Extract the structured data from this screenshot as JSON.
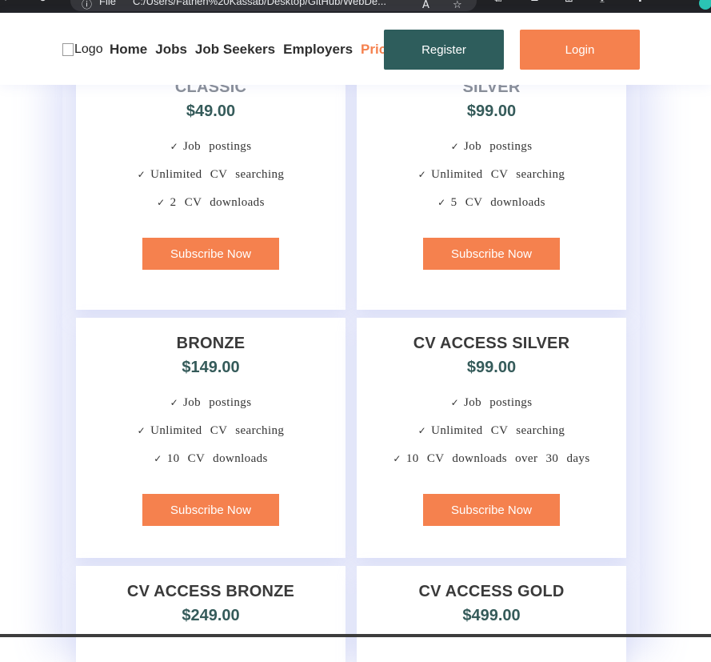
{
  "browser": {
    "file_label": "File",
    "address": "C:/Users/Fathen%20Kassab/Desktop/GitHub/WebDe..."
  },
  "header": {
    "logo_alt": "Logo",
    "nav": [
      "Home",
      "Jobs",
      "Job Seekers",
      "Employers",
      "Pricing"
    ],
    "active_nav": "Pricing",
    "register_label": "Register",
    "login_label": "Login"
  },
  "plans": [
    {
      "name": "CLASSIC",
      "price": "$49.00",
      "features": [
        "Job postings",
        "Unlimited CV searching",
        "2 CV downloads"
      ],
      "button": "Subscribe Now"
    },
    {
      "name": "SILVER",
      "price": "$99.00",
      "features": [
        "Job postings",
        "Unlimited CV searching",
        "5 CV downloads"
      ],
      "button": "Subscribe Now"
    },
    {
      "name": "BRONZE",
      "price": "$149.00",
      "features": [
        "Job postings",
        "Unlimited CV searching",
        "10 CV downloads"
      ],
      "button": "Subscribe Now"
    },
    {
      "name": "CV ACCESS SILVER",
      "price": "$99.00",
      "features": [
        "Job postings",
        "Unlimited CV searching",
        "10 CV downloads over 30 days"
      ],
      "button": "Subscribe Now"
    },
    {
      "name": "CV ACCESS BRONZE",
      "price": "$249.00",
      "features": [],
      "button": ""
    },
    {
      "name": "CV ACCESS GOLD",
      "price": "$499.00",
      "features": [],
      "button": ""
    }
  ],
  "colors": {
    "accent": "#f5814e",
    "primary": "#2e5d5c",
    "price": "#355b5a",
    "page_bg": "#eef0fc"
  }
}
